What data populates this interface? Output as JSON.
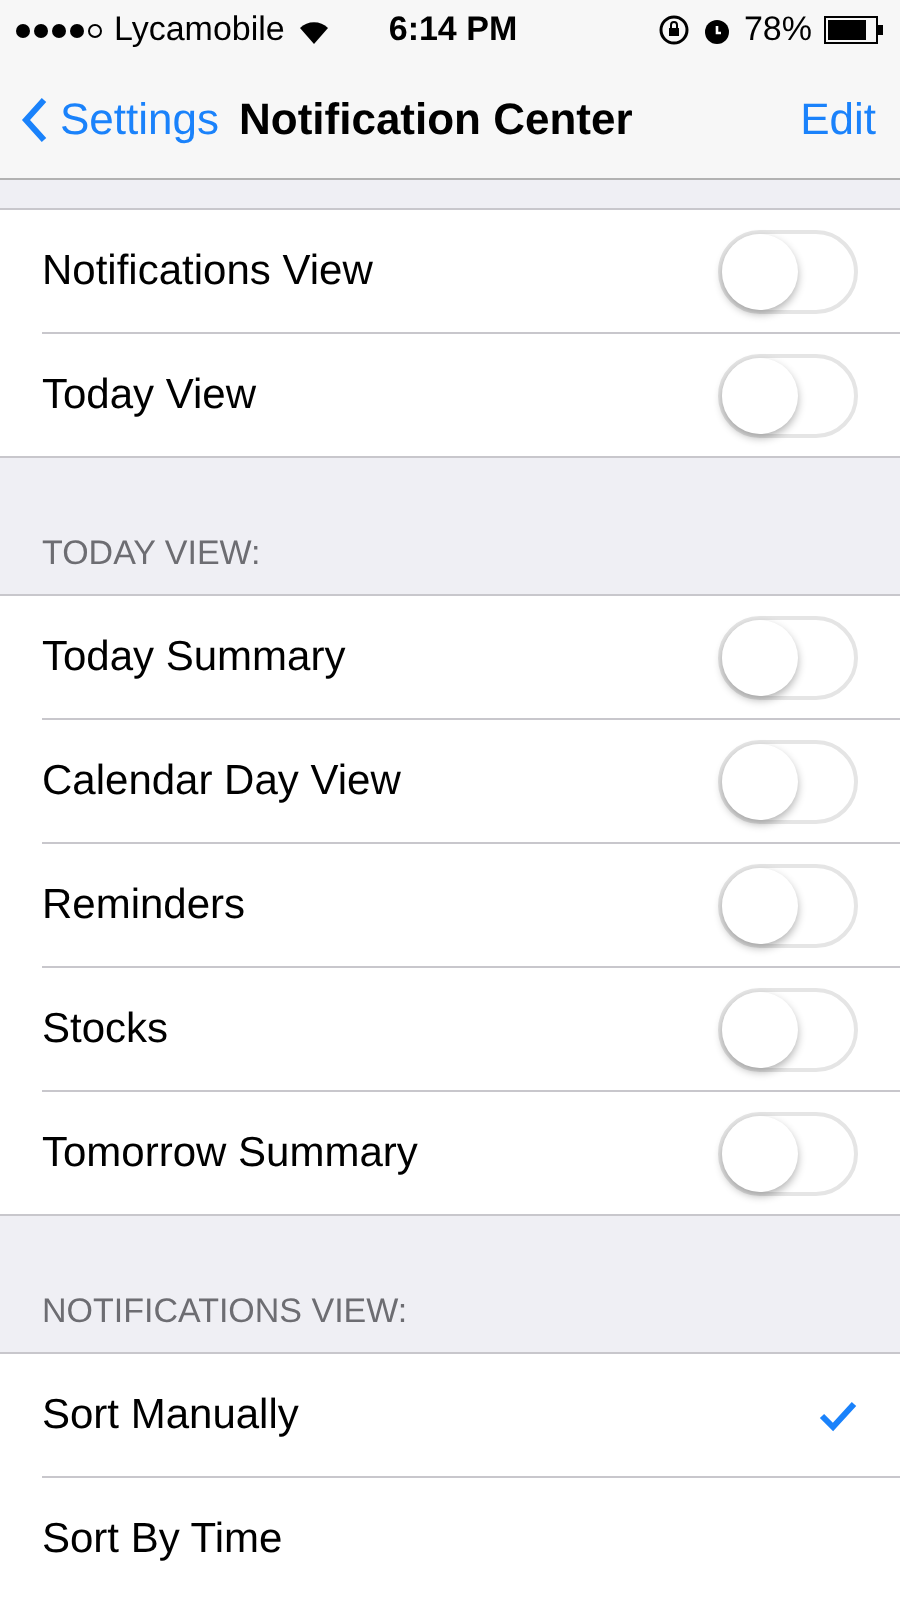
{
  "status_bar": {
    "carrier": "Lycamobile",
    "time": "6:14 PM",
    "battery": "78%"
  },
  "nav": {
    "back": "Settings",
    "title": "Notification Center",
    "action": "Edit"
  },
  "sections": [
    {
      "rows": [
        {
          "kind": "toggle",
          "label": "Notifications View",
          "on": false
        },
        {
          "kind": "toggle",
          "label": "Today View",
          "on": false
        }
      ]
    },
    {
      "header": "TODAY VIEW:",
      "rows": [
        {
          "kind": "toggle",
          "label": "Today Summary",
          "on": false
        },
        {
          "kind": "toggle",
          "label": "Calendar Day View",
          "on": false
        },
        {
          "kind": "toggle",
          "label": "Reminders",
          "on": false
        },
        {
          "kind": "toggle",
          "label": "Stocks",
          "on": false
        },
        {
          "kind": "toggle",
          "label": "Tomorrow Summary",
          "on": false
        }
      ]
    },
    {
      "header": "NOTIFICATIONS VIEW:",
      "rows": [
        {
          "kind": "check",
          "label": "Sort Manually",
          "selected": true
        },
        {
          "kind": "check",
          "label": "Sort By Time",
          "selected": false
        }
      ]
    }
  ]
}
